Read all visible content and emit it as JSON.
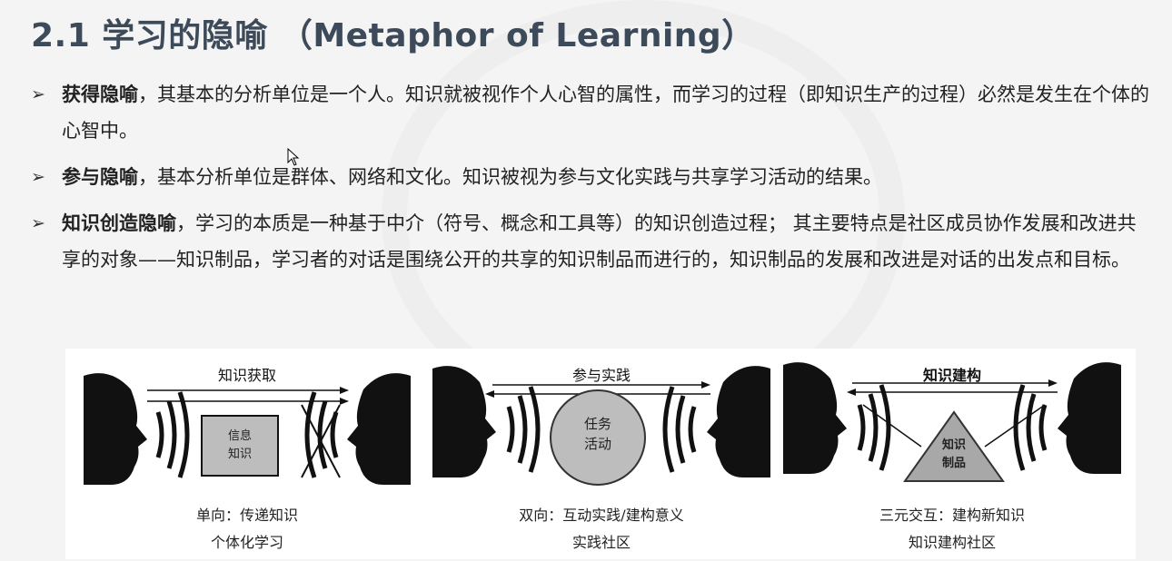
{
  "title": "2.1 学习的隐喻 （Metaphor of Learning）",
  "bullets": [
    {
      "term": "获得隐喻",
      "text": "，其基本的分析单位是一个人。知识就被视作个人心智的属性，而学习的过程（即知识生产的过程）必然是发生在个体的心智中。"
    },
    {
      "term": "参与隐喻",
      "text": "，基本分析单位是群体、网络和文化。知识被视为参与文化实践与共享学习活动的结果。"
    },
    {
      "term": "知识创造隐喻",
      "text": "，学习的本质是一种基于中介（符号、概念和工具等）的知识创造过程； 其主要特点是社区成员协作发展和改进共享的对象——知识制品，学习者的对话是围绕公开的共享的知识制品而进行的，知识制品的发展和改进是对话的出发点和目标。"
    }
  ],
  "figure": {
    "panels": [
      {
        "top_label": "知识获取",
        "center_label_1": "信息",
        "center_label_2": "知识",
        "caption_1": "单向：传递知识",
        "caption_2": "个体化学习"
      },
      {
        "top_label": "参与实践",
        "center_label_1": "任务",
        "center_label_2": "活动",
        "caption_1": "双向：互动实践/建构意义",
        "caption_2": "实践社区"
      },
      {
        "top_label": "知识建构",
        "center_label_1": "知识",
        "center_label_2": "制品",
        "caption_1": "三元交互：建构新知识",
        "caption_2": "知识建构社区"
      }
    ]
  }
}
